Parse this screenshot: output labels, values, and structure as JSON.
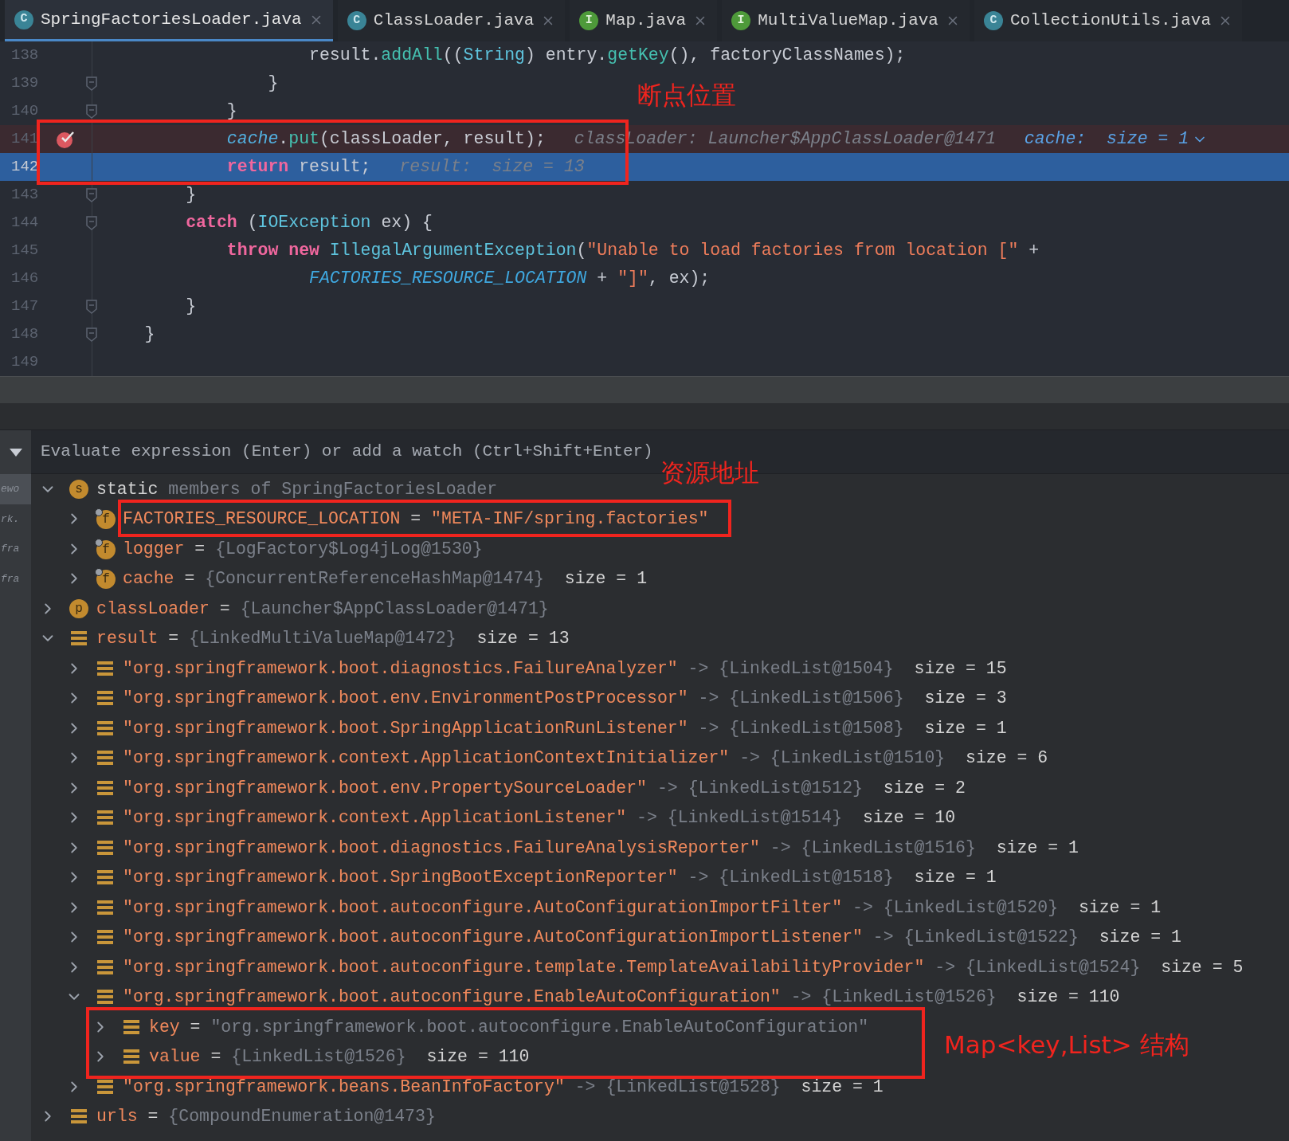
{
  "tabs": [
    {
      "label": "SpringFactoriesLoader.java",
      "kind": "class",
      "icon_letter": "C",
      "selected": true
    },
    {
      "label": "ClassLoader.java",
      "kind": "class",
      "icon_letter": "C",
      "selected": false
    },
    {
      "label": "Map.java",
      "kind": "interface",
      "icon_letter": "I",
      "selected": false
    },
    {
      "label": "MultiValueMap.java",
      "kind": "interface",
      "icon_letter": "I",
      "selected": false
    },
    {
      "label": "CollectionUtils.java",
      "kind": "class",
      "icon_letter": "C",
      "selected": false
    }
  ],
  "editor": {
    "lines": [
      {
        "number": "138",
        "fold": false,
        "breakpoint": false,
        "current": false,
        "tokens": [
          {
            "kind": "plain",
            "text": "                    result."
          },
          {
            "kind": "method",
            "text": "addAll"
          },
          {
            "kind": "plain",
            "text": "(("
          },
          {
            "kind": "type",
            "text": "String"
          },
          {
            "kind": "plain",
            "text": ") entry."
          },
          {
            "kind": "method",
            "text": "getKey"
          },
          {
            "kind": "plain",
            "text": "(), factoryClassNames);"
          }
        ]
      },
      {
        "number": "139",
        "fold": true,
        "breakpoint": false,
        "current": false,
        "tokens": [
          {
            "kind": "plain",
            "text": "                }"
          }
        ]
      },
      {
        "number": "140",
        "fold": true,
        "breakpoint": false,
        "current": false,
        "tokens": [
          {
            "kind": "plain",
            "text": "            }"
          }
        ]
      },
      {
        "number": "141",
        "fold": false,
        "breakpoint": true,
        "current": false,
        "tokens": [
          {
            "kind": "static_field",
            "text": "            cache"
          },
          {
            "kind": "plain",
            "text": "."
          },
          {
            "kind": "method",
            "text": "put"
          },
          {
            "kind": "plain",
            "text": "(classLoader, result);"
          }
        ],
        "hints": [
          {
            "kind": "variable",
            "text": "classLoader: Launcher$AppClassLoader@1471",
            "expandable": false
          },
          {
            "kind": "watch",
            "text": "cache:  size = 1",
            "expandable": true
          }
        ]
      },
      {
        "number": "142",
        "fold": false,
        "breakpoint": false,
        "current": true,
        "tokens": [
          {
            "kind": "keyword",
            "text": "            return"
          },
          {
            "kind": "plain",
            "text": " result;"
          }
        ],
        "hints": [
          {
            "kind": "variable",
            "text": "result:  size = 13",
            "expandable": false
          }
        ]
      },
      {
        "number": "143",
        "fold": true,
        "breakpoint": false,
        "current": false,
        "tokens": [
          {
            "kind": "plain",
            "text": "        }"
          }
        ]
      },
      {
        "number": "144",
        "fold": true,
        "breakpoint": false,
        "current": false,
        "tokens": [
          {
            "kind": "keyword",
            "text": "        catch"
          },
          {
            "kind": "plain",
            "text": " ("
          },
          {
            "kind": "type",
            "text": "IOException"
          },
          {
            "kind": "plain",
            "text": " ex) {"
          }
        ]
      },
      {
        "number": "145",
        "fold": false,
        "breakpoint": false,
        "current": false,
        "tokens": [
          {
            "kind": "keyword",
            "text": "            throw new "
          },
          {
            "kind": "type",
            "text": "IllegalArgumentException"
          },
          {
            "kind": "plain",
            "text": "("
          },
          {
            "kind": "string",
            "text": "\"Unable to load factories from location [\""
          },
          {
            "kind": "plain",
            "text": " +"
          }
        ]
      },
      {
        "number": "146",
        "fold": false,
        "breakpoint": false,
        "current": false,
        "tokens": [
          {
            "kind": "constant",
            "text": "                    FACTORIES_RESOURCE_LOCATION"
          },
          {
            "kind": "plain",
            "text": " + "
          },
          {
            "kind": "string",
            "text": "\"]\""
          },
          {
            "kind": "plain",
            "text": ", ex);"
          }
        ]
      },
      {
        "number": "147",
        "fold": true,
        "breakpoint": false,
        "current": false,
        "tokens": [
          {
            "kind": "plain",
            "text": "        }"
          }
        ]
      },
      {
        "number": "148",
        "fold": true,
        "breakpoint": false,
        "current": false,
        "tokens": [
          {
            "kind": "plain",
            "text": "    }"
          }
        ]
      },
      {
        "number": "149",
        "fold": false,
        "breakpoint": false,
        "current": false
      }
    ]
  },
  "frames": [
    {
      "text": "ewo",
      "selected": true
    },
    {
      "text": "rk.",
      "selected": false
    },
    {
      "text": "fra",
      "selected": false
    },
    {
      "text": "fra",
      "selected": false
    }
  ],
  "variables": {
    "placeholder": "Evaluate expression (Enter) or add a watch (Ctrl+Shift+Enter)",
    "items": [
      {
        "kind": "static",
        "icon_letter": "s",
        "name": "static",
        "value": "members of SpringFactoriesLoader",
        "expanded": true,
        "children": [
          {
            "kind": "field",
            "icon_letter": "f",
            "name": "FACTORIES_RESOURCE_LOCATION",
            "separator": "=",
            "value": "\"META-INF/spring.factories\"",
            "expanded": false
          },
          {
            "kind": "field",
            "icon_letter": "f",
            "name": "logger",
            "separator": "=",
            "value": "{LogFactory$Log4jLog@1530}",
            "expanded": false
          },
          {
            "kind": "field",
            "icon_letter": "f",
            "name": "cache",
            "separator": "=",
            "value": "{ConcurrentReferenceHashMap@1474}",
            "size": "size = 1",
            "expanded": false
          }
        ]
      },
      {
        "kind": "param",
        "icon_letter": "p",
        "name": "classLoader",
        "separator": "=",
        "value": "{Launcher$AppClassLoader@1471}",
        "expanded": false
      },
      {
        "kind": "map",
        "name": "result",
        "separator": "=",
        "value": "{LinkedMultiValueMap@1472}",
        "size": "size = 13",
        "expanded": true,
        "children": [
          {
            "kind": "map",
            "name": "\"org.springframework.boot.diagnostics.FailureAnalyzer\"",
            "separator": "->",
            "value": "{LinkedList@1504}",
            "size": "size = 15",
            "expanded": false
          },
          {
            "kind": "map",
            "name": "\"org.springframework.boot.env.EnvironmentPostProcessor\"",
            "separator": "->",
            "value": "{LinkedList@1506}",
            "size": "size = 3",
            "expanded": false
          },
          {
            "kind": "map",
            "name": "\"org.springframework.boot.SpringApplicationRunListener\"",
            "separator": "->",
            "value": "{LinkedList@1508}",
            "size": "size = 1",
            "expanded": false
          },
          {
            "kind": "map",
            "name": "\"org.springframework.context.ApplicationContextInitializer\"",
            "separator": "->",
            "value": "{LinkedList@1510}",
            "size": "size = 6",
            "expanded": false
          },
          {
            "kind": "map",
            "name": "\"org.springframework.boot.env.PropertySourceLoader\"",
            "separator": "->",
            "value": "{LinkedList@1512}",
            "size": "size = 2",
            "expanded": false
          },
          {
            "kind": "map",
            "name": "\"org.springframework.context.ApplicationListener\"",
            "separator": "->",
            "value": "{LinkedList@1514}",
            "size": "size = 10",
            "expanded": false
          },
          {
            "kind": "map",
            "name": "\"org.springframework.boot.diagnostics.FailureAnalysisReporter\"",
            "separator": "->",
            "value": "{LinkedList@1516}",
            "size": "size = 1",
            "expanded": false
          },
          {
            "kind": "map",
            "name": "\"org.springframework.boot.SpringBootExceptionReporter\"",
            "separator": "->",
            "value": "{LinkedList@1518}",
            "size": "size = 1",
            "expanded": false
          },
          {
            "kind": "map",
            "name": "\"org.springframework.boot.autoconfigure.AutoConfigurationImportFilter\"",
            "separator": "->",
            "value": "{LinkedList@1520}",
            "size": "size = 1",
            "expanded": false
          },
          {
            "kind": "map",
            "name": "\"org.springframework.boot.autoconfigure.AutoConfigurationImportListener\"",
            "separator": "->",
            "value": "{LinkedList@1522}",
            "size": "size = 1",
            "expanded": false
          },
          {
            "kind": "map",
            "name": "\"org.springframework.boot.autoconfigure.template.TemplateAvailabilityProvider\"",
            "separator": "->",
            "value": "{LinkedList@1524}",
            "size": "size = 5",
            "expanded": false
          },
          {
            "kind": "map",
            "name": "\"org.springframework.boot.autoconfigure.EnableAutoConfiguration\"",
            "separator": "->",
            "value": "{LinkedList@1526}",
            "size": "size = 110",
            "expanded": true,
            "children": [
              {
                "kind": "map",
                "name": "key",
                "separator": "=",
                "value": "\"org.springframework.boot.autoconfigure.EnableAutoConfiguration\"",
                "expanded": false
              },
              {
                "kind": "map",
                "name": "value",
                "separator": "=",
                "value": "{LinkedList@1526}",
                "size": "size = 110",
                "expanded": false
              }
            ]
          },
          {
            "kind": "map",
            "name": "\"org.springframework.beans.BeanInfoFactory\"",
            "separator": "->",
            "value": "{LinkedList@1528}",
            "size": "size = 1",
            "expanded": false
          }
        ]
      },
      {
        "kind": "map",
        "name": "urls",
        "separator": "=",
        "value": "{CompoundEnumeration@1473}",
        "expanded": false
      }
    ]
  },
  "annotations": [
    {
      "text": "断点位置"
    },
    {
      "text": "资源地址"
    },
    {
      "text": "Map<key,List> 结构"
    }
  ]
}
